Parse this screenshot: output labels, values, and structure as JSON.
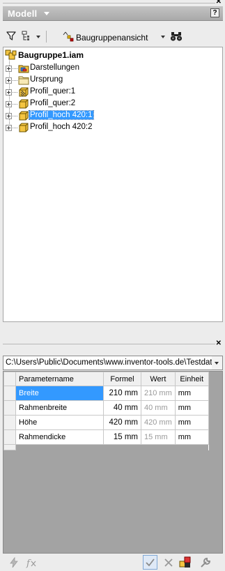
{
  "panel": {
    "title": "Modell",
    "help_label": "?"
  },
  "toolbar": {
    "view_label": "Baugruppenansicht"
  },
  "tree": {
    "root": {
      "label": "Baugruppe1.iam"
    },
    "items": [
      {
        "label": "Darstellungen",
        "icon": "representations-icon",
        "selected": false
      },
      {
        "label": "Ursprung",
        "icon": "folder-icon",
        "selected": false
      },
      {
        "label": "Profil_quer:1",
        "icon": "part-icon",
        "selected": false
      },
      {
        "label": "Profil_quer:2",
        "icon": "part-icon",
        "selected": false
      },
      {
        "label": "Profil_hoch 420:1",
        "icon": "part-icon",
        "selected": true
      },
      {
        "label": "Profil_hoch 420:2",
        "icon": "part-icon",
        "selected": false
      }
    ]
  },
  "parameters": {
    "path": "C:\\Users\\Public\\Documents\\www.inventor-tools.de\\Testdate",
    "columns": [
      "Parametername",
      "Formel",
      "Wert",
      "Einheit"
    ],
    "rows": [
      {
        "name": "Breite",
        "formel": "210 mm",
        "wert": "210 mm",
        "einheit": "mm"
      },
      {
        "name": "Rahmenbreite",
        "formel": "40 mm",
        "wert": "40 mm",
        "einheit": "mm"
      },
      {
        "name": "Höhe",
        "formel": "420 mm",
        "wert": "420 mm",
        "einheit": "mm"
      },
      {
        "name": "Rahmendicke",
        "formel": "15 mm",
        "wert": "15 mm",
        "einheit": "mm"
      }
    ]
  },
  "colors": {
    "selection": "#3399ff",
    "header_bar": "#b4b4b4",
    "grid_background": "#a3a3a3"
  }
}
